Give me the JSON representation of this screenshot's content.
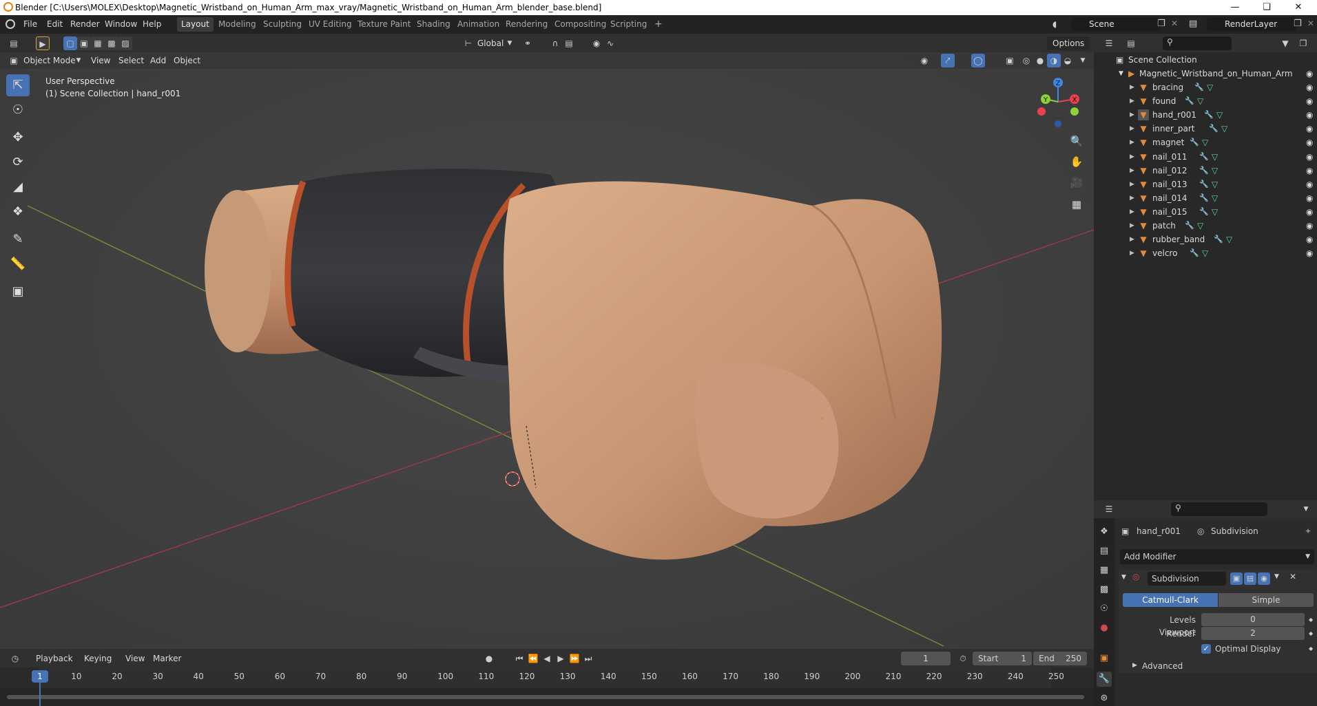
{
  "window": {
    "title": "Blender [C:\\Users\\MOLEX\\Desktop\\Magnetic_Wristband_on_Human_Arm_max_vray/Magnetic_Wristband_on_Human_Arm_blender_base.blend]",
    "minimize": "—",
    "maximize": "❏",
    "close": "✕"
  },
  "menu": [
    "File",
    "Edit",
    "Render",
    "Window",
    "Help"
  ],
  "workspaces": [
    {
      "label": "Layout",
      "active": true
    },
    {
      "label": "Modeling",
      "active": false
    },
    {
      "label": "Sculpting",
      "active": false
    },
    {
      "label": "UV Editing",
      "active": false
    },
    {
      "label": "Texture Paint",
      "active": false
    },
    {
      "label": "Shading",
      "active": false
    },
    {
      "label": "Animation",
      "active": false
    },
    {
      "label": "Rendering",
      "active": false
    },
    {
      "label": "Compositing",
      "active": false
    },
    {
      "label": "Scripting",
      "active": false
    }
  ],
  "add_workspace": "+",
  "scene": {
    "name": "Scene",
    "render_layer": "RenderLayer"
  },
  "viewport": {
    "mode": "Object Mode",
    "menus": [
      "View",
      "Select",
      "Add",
      "Object"
    ],
    "transform_orientation": "Global",
    "options_label": "Options",
    "perspective_label": "User Perspective",
    "collection_label": "(1) Scene Collection | hand_r001",
    "gizmo_axes": {
      "x": "X",
      "y": "Y",
      "z": "Z"
    }
  },
  "colors": {
    "accent": "#4772b3",
    "object_orange": "#e08a3c",
    "mesh_green": "#5ad1a0",
    "modifier_blue": "#7aa6e6",
    "axis_x": "#e8404e",
    "axis_y": "#8bd13a",
    "axis_z": "#3a8ae8",
    "skin": "#c99a78",
    "band": "#303236",
    "band_trim": "#b8502a"
  },
  "outliner": {
    "root": "Scene Collection",
    "collection": "Magnetic_Wristband_on_Human_Arm",
    "objects": [
      "bracing",
      "found",
      "hand_r001",
      "inner_part",
      "magnet",
      "nail_011",
      "nail_012",
      "nail_013",
      "nail_014",
      "nail_015",
      "patch",
      "rubber_band",
      "velcro"
    ],
    "selected": "hand_r001"
  },
  "properties": {
    "object_name": "hand_r001",
    "modifier_breadcrumb": "Subdivision",
    "add_modifier_label": "Add Modifier",
    "modifier": {
      "name": "Subdivision",
      "types": [
        "Catmull-Clark",
        "Simple"
      ],
      "active_type": "Catmull-Clark",
      "levels_viewport_label": "Levels Viewport",
      "levels_viewport_value": "0",
      "render_label": "Render",
      "render_value": "2",
      "optimal_display_label": "Optimal Display",
      "optimal_display_checked": true,
      "advanced_label": "Advanced"
    }
  },
  "timeline": {
    "menus": [
      "Playback",
      "Keying",
      "View",
      "Marker"
    ],
    "current_frame": "1",
    "start_label": "Start",
    "start_value": "1",
    "end_label": "End",
    "end_value": "250",
    "ticks": [
      "1",
      "10",
      "20",
      "30",
      "40",
      "50",
      "60",
      "70",
      "80",
      "90",
      "100",
      "110",
      "120",
      "130",
      "140",
      "150",
      "160",
      "170",
      "180",
      "190",
      "200",
      "210",
      "220",
      "230",
      "240",
      "250"
    ]
  },
  "icons": {
    "blender_logo": "blender-logo-icon",
    "search": "search-icon",
    "filter": "filter-icon",
    "eye": "eye-icon",
    "wrench": "wrench-icon"
  }
}
